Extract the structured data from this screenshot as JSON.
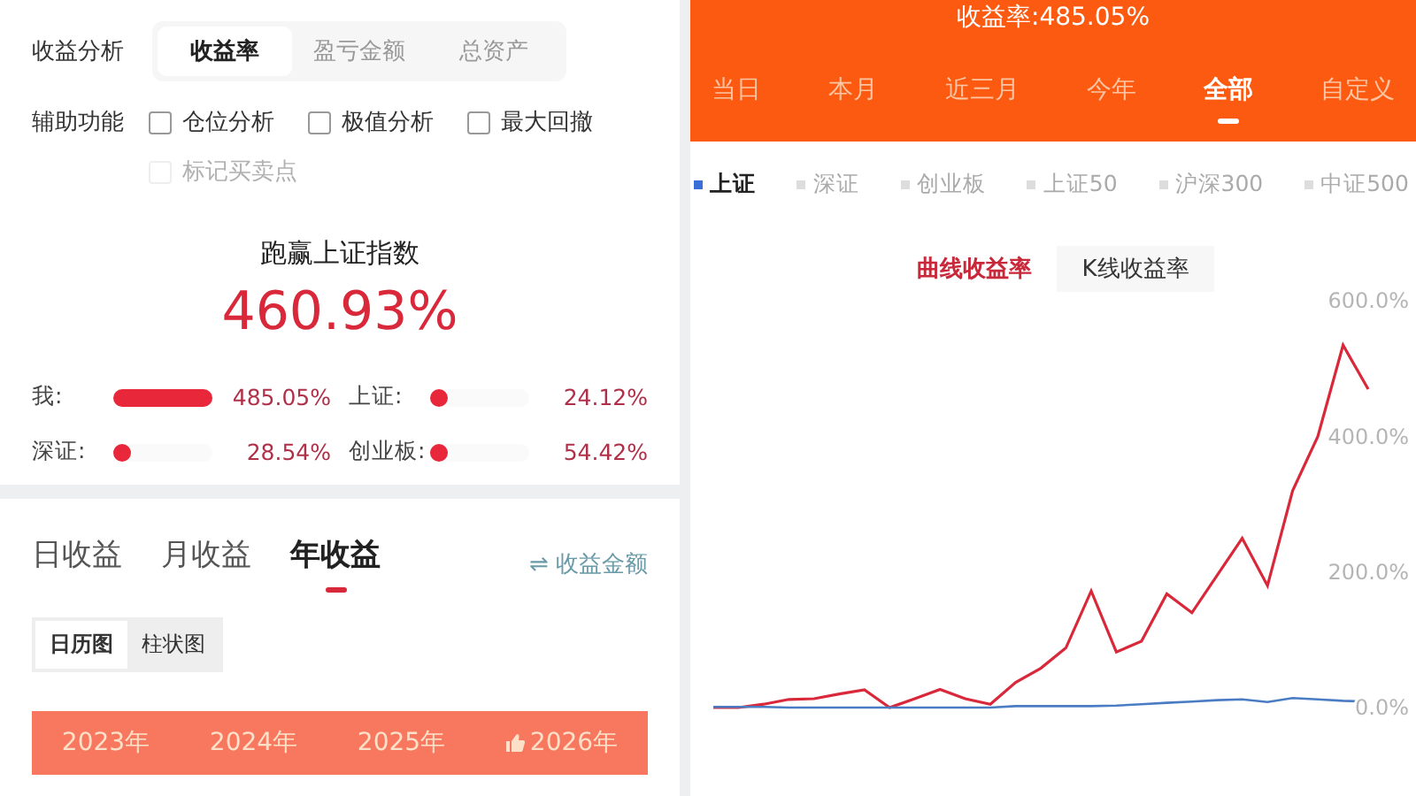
{
  "analysis": {
    "label": "收益分析",
    "tabs": [
      {
        "label": "收益率",
        "selected": true
      },
      {
        "label": "盈亏金额",
        "selected": false
      },
      {
        "label": "总资产",
        "selected": false
      }
    ]
  },
  "tools": {
    "label": "辅助功能",
    "options": [
      {
        "label": "仓位分析",
        "checked": false,
        "disabled": false
      },
      {
        "label": "极值分析",
        "checked": false,
        "disabled": false
      },
      {
        "label": "最大回撤",
        "checked": false,
        "disabled": false
      },
      {
        "label": "标记买卖点",
        "checked": false,
        "disabled": true
      }
    ]
  },
  "summary": {
    "title": "跑赢上证指数",
    "value": "460.93%"
  },
  "comparison": [
    {
      "name": "我:",
      "level": 1,
      "reading": "485.05%"
    },
    {
      "name": "上证:",
      "level": 0.05,
      "reading": "24.12%"
    },
    {
      "name": "深证:",
      "level": 0.06,
      "reading": "28.54%"
    },
    {
      "name": "创业板:",
      "level": 0.11,
      "reading": "54.42%"
    }
  ],
  "period_tabs": [
    {
      "label": "日收益",
      "selected": false
    },
    {
      "label": "月收益",
      "selected": false
    },
    {
      "label": "年收益",
      "selected": true
    }
  ],
  "switch_link": {
    "icon": "⇌",
    "label": "收益金额"
  },
  "view_toggle": [
    {
      "label": "日历图",
      "selected": true
    },
    {
      "label": "柱状图",
      "selected": false
    }
  ],
  "years": [
    {
      "label": "2023年",
      "thumbs_up": false
    },
    {
      "label": "2024年",
      "thumbs_up": false
    },
    {
      "label": "2025年",
      "thumbs_up": false
    },
    {
      "label": "2026年",
      "thumbs_up": true
    }
  ],
  "header": {
    "title": "收益率:485.05%"
  },
  "range_tabs": [
    {
      "label": "当日",
      "selected": false
    },
    {
      "label": "本月",
      "selected": false
    },
    {
      "label": "近三月",
      "selected": false
    },
    {
      "label": "今年",
      "selected": false
    },
    {
      "label": "全部",
      "selected": true
    },
    {
      "label": "自定义",
      "selected": false
    }
  ],
  "benchmarks": [
    {
      "label": "上证",
      "selected": true
    },
    {
      "label": "深证",
      "selected": false
    },
    {
      "label": "创业板",
      "selected": false
    },
    {
      "label": "上证50",
      "selected": false
    },
    {
      "label": "沪深300",
      "selected": false
    },
    {
      "label": "中证500",
      "selected": false
    }
  ],
  "chart_mode": [
    {
      "label": "曲线收益率",
      "selected": true
    },
    {
      "label": "K线收益率",
      "selected": false
    }
  ],
  "chart": {
    "chart_data": {
      "type": "line",
      "categories": [
        null,
        null,
        null,
        null,
        null,
        null,
        null,
        null,
        null,
        null,
        null,
        null,
        null,
        null,
        null,
        null,
        null,
        null,
        null,
        null,
        null,
        null,
        null,
        null,
        null,
        null,
        null
      ],
      "ylim": [
        0,
        600
      ],
      "yticks": [
        {
          "value": 0,
          "label": "0.0%"
        },
        {
          "value": 200,
          "label": "200.0%"
        },
        {
          "value": 400,
          "label": "400.0%"
        },
        {
          "value": 600,
          "label": "600.0%"
        }
      ],
      "series": [
        {
          "color": "#d8283a",
          "values": [
            0,
            0,
            5,
            12,
            13,
            20,
            26,
            0,
            13,
            27,
            13,
            5,
            37,
            58,
            88,
            172,
            82,
            98,
            168,
            140,
            195,
            250,
            180,
            320,
            400,
            535,
            470
          ]
        },
        {
          "color": "#4a7cc4",
          "values": [
            1,
            1,
            1,
            0,
            0,
            0,
            0,
            0,
            0,
            0,
            0,
            0,
            2,
            2,
            2,
            2,
            3,
            5,
            7,
            9,
            11,
            12,
            8,
            14,
            12,
            10,
            9
          ]
        }
      ]
    }
  }
}
